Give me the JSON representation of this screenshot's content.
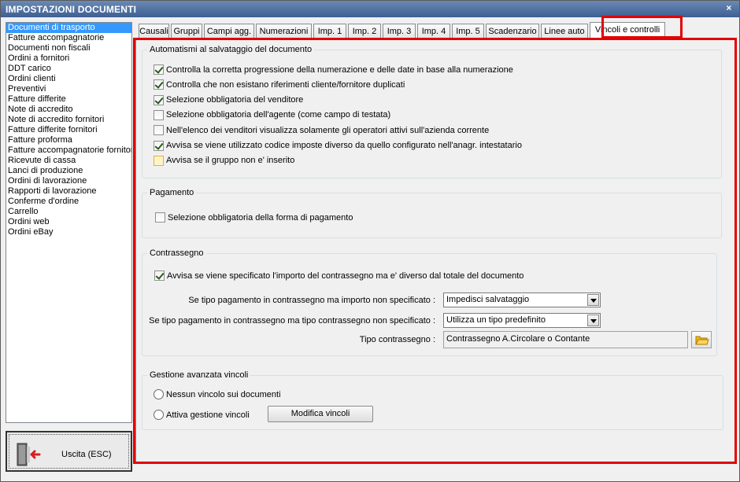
{
  "window": {
    "title": "IMPOSTAZIONI DOCUMENTI",
    "close_glyph": "×"
  },
  "doc_list": [
    "Documenti di trasporto",
    "Fatture accompagnatorie",
    "Documenti non fiscali",
    "Ordini a fornitori",
    "DDT carico",
    "Ordini clienti",
    "Preventivi",
    "Fatture differite",
    "Note di accredito",
    "Note di accredito fornitori",
    "Fatture differite fornitori",
    "Fatture proforma",
    "Fatture accompagnatorie fornitori",
    "Ricevute di cassa",
    "Lanci di produzione",
    "Ordini di lavorazione",
    "Rapporti di lavorazione",
    "Conferme d'ordine",
    "Carrello",
    "Ordini web",
    "Ordini eBay"
  ],
  "selected_doc": "Documenti di trasporto",
  "exit_button": {
    "label": "Uscita (ESC)",
    "icon": "exit-door-icon"
  },
  "tabs": [
    "Causali",
    "Gruppi",
    "Campi agg.",
    "Numerazioni",
    "Imp. 1",
    "Imp. 2",
    "Imp. 3",
    "Imp. 4",
    "Imp. 5",
    "Scadenzario",
    "Linee auto",
    "Vincoli e controlli"
  ],
  "active_tab": "Vincoli e controlli",
  "highlight_color": "#e30000",
  "automatismi": {
    "legend": "Automatismi al salvataggio del documento",
    "items": [
      {
        "label": "Controlla la corretta progressione della numerazione e delle date in base alla numerazione",
        "checked": true
      },
      {
        "label": "Controlla che non esistano riferimenti cliente/fornitore duplicati",
        "checked": true
      },
      {
        "label": "Selezione obbligatoria del venditore",
        "checked": true
      },
      {
        "label": "Selezione obbligatoria dell'agente (come campo di testata)",
        "checked": false
      },
      {
        "label": "Nell'elenco dei venditori visualizza solamente gli operatori attivi sull'azienda corrente",
        "checked": false
      },
      {
        "label": "Avvisa se viene utilizzato codice imposte diverso da quello configurato nell'anagr. intestatario",
        "checked": true
      },
      {
        "label": "Avvisa se il gruppo non e' inserito",
        "checked": false,
        "focused": true
      }
    ]
  },
  "pagamento": {
    "legend": "Pagamento",
    "items": [
      {
        "label": "Selezione obbligatoria della forma di pagamento",
        "checked": false
      }
    ]
  },
  "contrassegno": {
    "legend": "Contrassegno",
    "warn_checkbox": {
      "label": "Avvisa se viene specificato l'importo del contrassegno ma e' diverso dal totale del documento",
      "checked": true
    },
    "importo_label": "Se tipo pagamento in contrassegno ma importo non specificato :",
    "importo_value": "Impedisci salvataggio",
    "tipo_label": "Se tipo pagamento in contrassegno ma tipo contrassegno non specificato :",
    "tipo_value": "Utilizza un tipo predefinito",
    "tipo_contrassegno_label": "Tipo contrassegno :",
    "tipo_contrassegno_value": "Contrassegno A.Circolare o Contante"
  },
  "vincoli": {
    "legend": "Gestione avanzata vincoli",
    "option_none": "Nessun vincolo sui documenti",
    "option_enable": "Attiva gestione vincoli",
    "modify_button": "Modifica vincoli"
  }
}
